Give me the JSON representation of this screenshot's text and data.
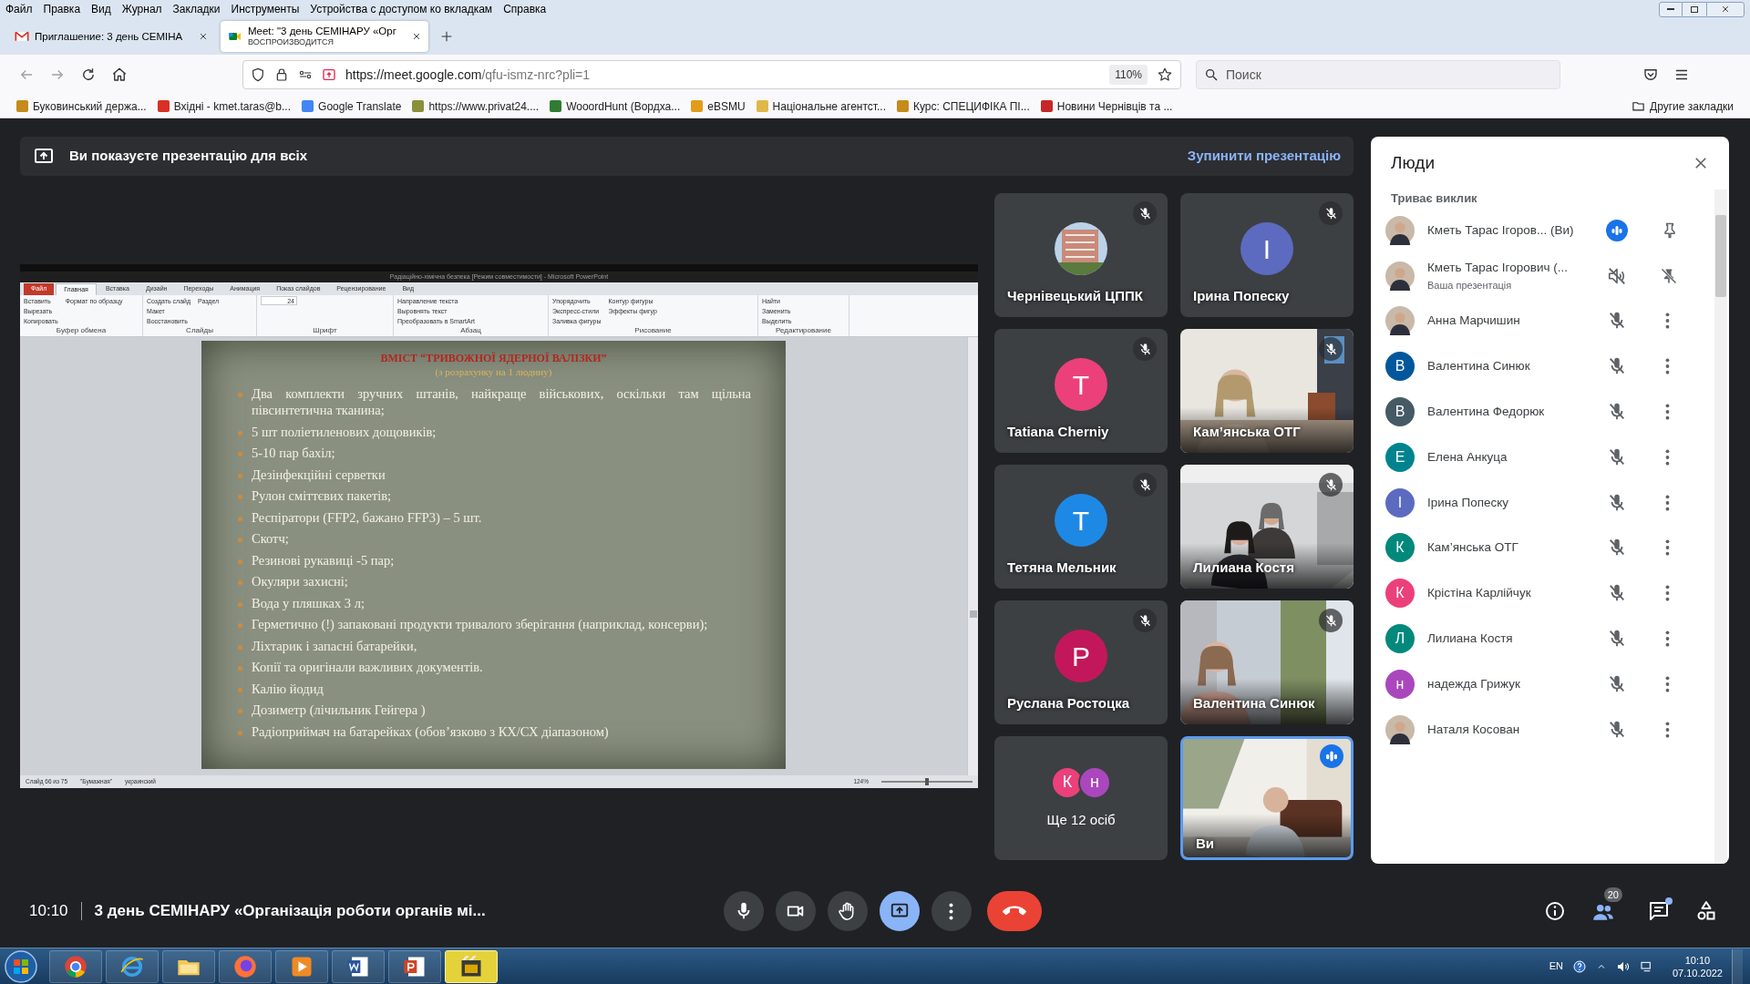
{
  "browser": {
    "menu": [
      "Файл",
      "Правка",
      "Вид",
      "Журнал",
      "Закладки",
      "Инструменты",
      "Устройства с доступом ко вкладкам",
      "Справка"
    ],
    "tabs": [
      {
        "kind": "mail",
        "title": "Приглашение: 3 день СЕМІНА",
        "selected": false
      },
      {
        "kind": "meet",
        "title": "Meet: \"3 день СЕМІНАРУ «Орг",
        "subtitle": "ВОСПРОИЗВОДИТСЯ",
        "selected": true
      }
    ],
    "url_host": "https://meet.google.com",
    "url_path": "/qfu-ismz-nrc?pli=1",
    "zoom": "110%",
    "search_placeholder": "Поиск",
    "bookmarks": [
      {
        "label": "Буковинський держа...",
        "color": "#c58b1c"
      },
      {
        "label": "Вхідні - kmet.taras@b...",
        "color": "#d93025"
      },
      {
        "label": "Google Translate",
        "color": "#4285f4"
      },
      {
        "label": "https://www.privat24....",
        "color": "#8a8f3a"
      },
      {
        "label": "WooordHunt (Вордха...",
        "color": "#2e7d32"
      },
      {
        "label": "eBSMU",
        "color": "#e39b1b"
      },
      {
        "label": "Національне агентст...",
        "color": "#e0b84a"
      },
      {
        "label": "Курс: СПЕЦИФІКА ПІ...",
        "color": "#c58b1c"
      },
      {
        "label": "Новини Чернівців та ...",
        "color": "#c62828"
      }
    ],
    "other_bookmarks": "Другие закладки"
  },
  "banner": {
    "text": "Ви показуєте презентацію для всіх",
    "action": "Зупинити презентацію"
  },
  "presentation": {
    "window_title": "Радіаційно-хімічна безпека [Режим совместимости] - Microsoft PowerPoint",
    "ribbon_tabs": [
      {
        "label": "Файл",
        "kind": "file",
        "selected": false
      },
      {
        "label": "Главная",
        "kind": "tab",
        "selected": true
      },
      {
        "label": "Вставка",
        "kind": "tab",
        "selected": false
      },
      {
        "label": "Дизайн",
        "kind": "tab",
        "selected": false
      },
      {
        "label": "Переходы",
        "kind": "tab",
        "selected": false
      },
      {
        "label": "Анимация",
        "kind": "tab",
        "selected": false
      },
      {
        "label": "Показ слайдов",
        "kind": "tab",
        "selected": false
      },
      {
        "label": "Рецензирование",
        "kind": "tab",
        "selected": false
      },
      {
        "label": "Вид",
        "kind": "tab",
        "selected": false
      }
    ],
    "ribbon_groups": [
      {
        "label": "Буфер обмена",
        "items": [
          "Вставить",
          "Вырезать",
          "Копировать",
          "Формат по образцу"
        ]
      },
      {
        "label": "Слайды",
        "items": [
          "Создать слайд",
          "Макет",
          "Восстановить",
          "Раздел"
        ]
      },
      {
        "label": "Шрифт",
        "field": "24"
      },
      {
        "label": "Абзац",
        "items": [
          "Направление текста",
          "Выровнять текст",
          "Преобразовать в SmartArt"
        ]
      },
      {
        "label": "Рисование",
        "items": [
          "Упорядочить",
          "Экспресс-стили",
          "Заливка фигуры",
          "Контур фигуры",
          "Эффекты фигур"
        ]
      },
      {
        "label": "Редактирование",
        "items": [
          "Найти",
          "Заменить",
          "Выделить"
        ]
      }
    ],
    "slide_title": "ВМІСТ “ТРИВОЖНОЇ ЯДЕРНОЇ ВАЛІЗКИ”",
    "slide_subtitle": "(з розрахунку на 1 людину)",
    "bullets": [
      "Два комплекти зручних штанів, найкраще військових, оскільки там щільна півсинтетична тканина;",
      "5 шт поліетиленових дощовиків;",
      "5-10 пар бахіл;",
      "Дезінфекційні серветки",
      "Рулон сміттєвих пакетів;",
      "Респіратори (FFP2, бажано FFP3) – 5 шт.",
      "Скотч;",
      "Резинові рукавиці -5 пар;",
      "Окуляри захисні;",
      "Вода у пляшках 3 л;",
      "Герметично (!) запаковані продукти тривалого зберігання (наприклад, консерви);",
      "Ліхтарик і запасні батарейки,",
      "Копії та оригінали важливих документів.",
      "Калію йодид",
      "Дозиметр (лічильник Гейгера )",
      "Радіоприймач на батарейках (обов’язково з КХ/СХ діапазоном)"
    ],
    "status": [
      "Слайд 66 из 75",
      "\"Бумажная\"",
      "украинский"
    ],
    "zoom": "124%",
    "zoom_slider": {
      "level": 0.5
    }
  },
  "tiles": [
    {
      "kind": "image-avatar",
      "name": "Чернівецький ЦППК",
      "muted": true
    },
    {
      "kind": "letter",
      "letter": "І",
      "color": "#5c6bc0",
      "name": "Ірина Попеску",
      "muted": true
    },
    {
      "kind": "letter",
      "letter": "T",
      "color": "#ec407a",
      "name": "Tatiana Cherniy",
      "muted": true
    },
    {
      "kind": "video",
      "name": "Кам’янська ОТГ",
      "muted": true
    },
    {
      "kind": "letter",
      "letter": "Т",
      "color": "#1e88e5",
      "name": "Тетяна Мельник",
      "muted": true
    },
    {
      "kind": "video",
      "name": "Лилиана Костя",
      "muted": true
    },
    {
      "kind": "letter",
      "letter": "Р",
      "color": "#c2185b",
      "name": "Руслана Ростоцка",
      "muted": true
    },
    {
      "kind": "video",
      "name": "Валентина Синюк",
      "muted": true
    },
    {
      "kind": "more",
      "avatars": [
        {
          "letter": "К",
          "color": "#ec407a"
        },
        {
          "letter": "н",
          "color": "#ab47bc"
        }
      ],
      "label": "Ще 12 осіб"
    },
    {
      "kind": "self",
      "name": "Ви",
      "speaking": true,
      "muted": false
    }
  ],
  "people": {
    "title": "Люди",
    "section": "Триває виклик",
    "rows": [
      {
        "kind": "self",
        "name": "Кметь Тарас Ігоров... (Ви)",
        "muted": false
      },
      {
        "kind": "presentation",
        "name": "Кметь Тарас Ігорович (...",
        "subtitle": "Ваша презентація",
        "muted": true
      },
      {
        "name": "Анна Марчишин",
        "muted": true
      },
      {
        "kind": "letter",
        "letter": "В",
        "color": "#01579b",
        "name": "Валентина Синюк",
        "muted": true
      },
      {
        "kind": "letter",
        "letter": "В",
        "color": "#455a64",
        "name": "Валентина Федорюк",
        "muted": true
      },
      {
        "kind": "letter",
        "letter": "Е",
        "color": "#00838f",
        "name": "Елена Анкуца",
        "muted": true
      },
      {
        "kind": "letter",
        "letter": "І",
        "color": "#5c6bc0",
        "name": "Ірина Попеску",
        "muted": true
      },
      {
        "kind": "letter",
        "letter": "К",
        "color": "#00897b",
        "name": "Кам’янська ОТГ",
        "muted": true
      },
      {
        "kind": "letter",
        "letter": "К",
        "color": "#ec407a",
        "name": "Крістіна Карлійчук",
        "muted": true
      },
      {
        "kind": "letter",
        "letter": "Л",
        "color": "#00897b",
        "name": "Лилиана Костя",
        "muted": true
      },
      {
        "kind": "letter",
        "letter": "н",
        "color": "#ab47bc",
        "name": "надежда Грижук",
        "muted": true
      },
      {
        "name": "Наталя Косован",
        "muted": true
      }
    ]
  },
  "call_bar": {
    "time": "10:10",
    "meeting_title": "3 день СЕМІНАРУ «Організація роботи органів мі...",
    "controls": [
      {
        "kind": "mic"
      },
      {
        "kind": "camera"
      },
      {
        "kind": "hand"
      },
      {
        "kind": "present",
        "selected": true
      },
      {
        "kind": "more"
      },
      {
        "kind": "end"
      }
    ],
    "people_count": "20",
    "chat_unread": true
  },
  "taskbar": {
    "apps": [
      {
        "kind": "chrome",
        "selected": false
      },
      {
        "kind": "ie",
        "selected": false
      },
      {
        "kind": "explorer",
        "selected": false
      },
      {
        "kind": "firefox",
        "selected": false
      },
      {
        "kind": "media",
        "selected": false
      },
      {
        "kind": "word",
        "selected": false
      },
      {
        "kind": "powerpoint",
        "selected": false
      },
      {
        "kind": "video",
        "selected": true
      }
    ],
    "language": "EN",
    "time": "10:10",
    "date": "07.10.2022"
  }
}
